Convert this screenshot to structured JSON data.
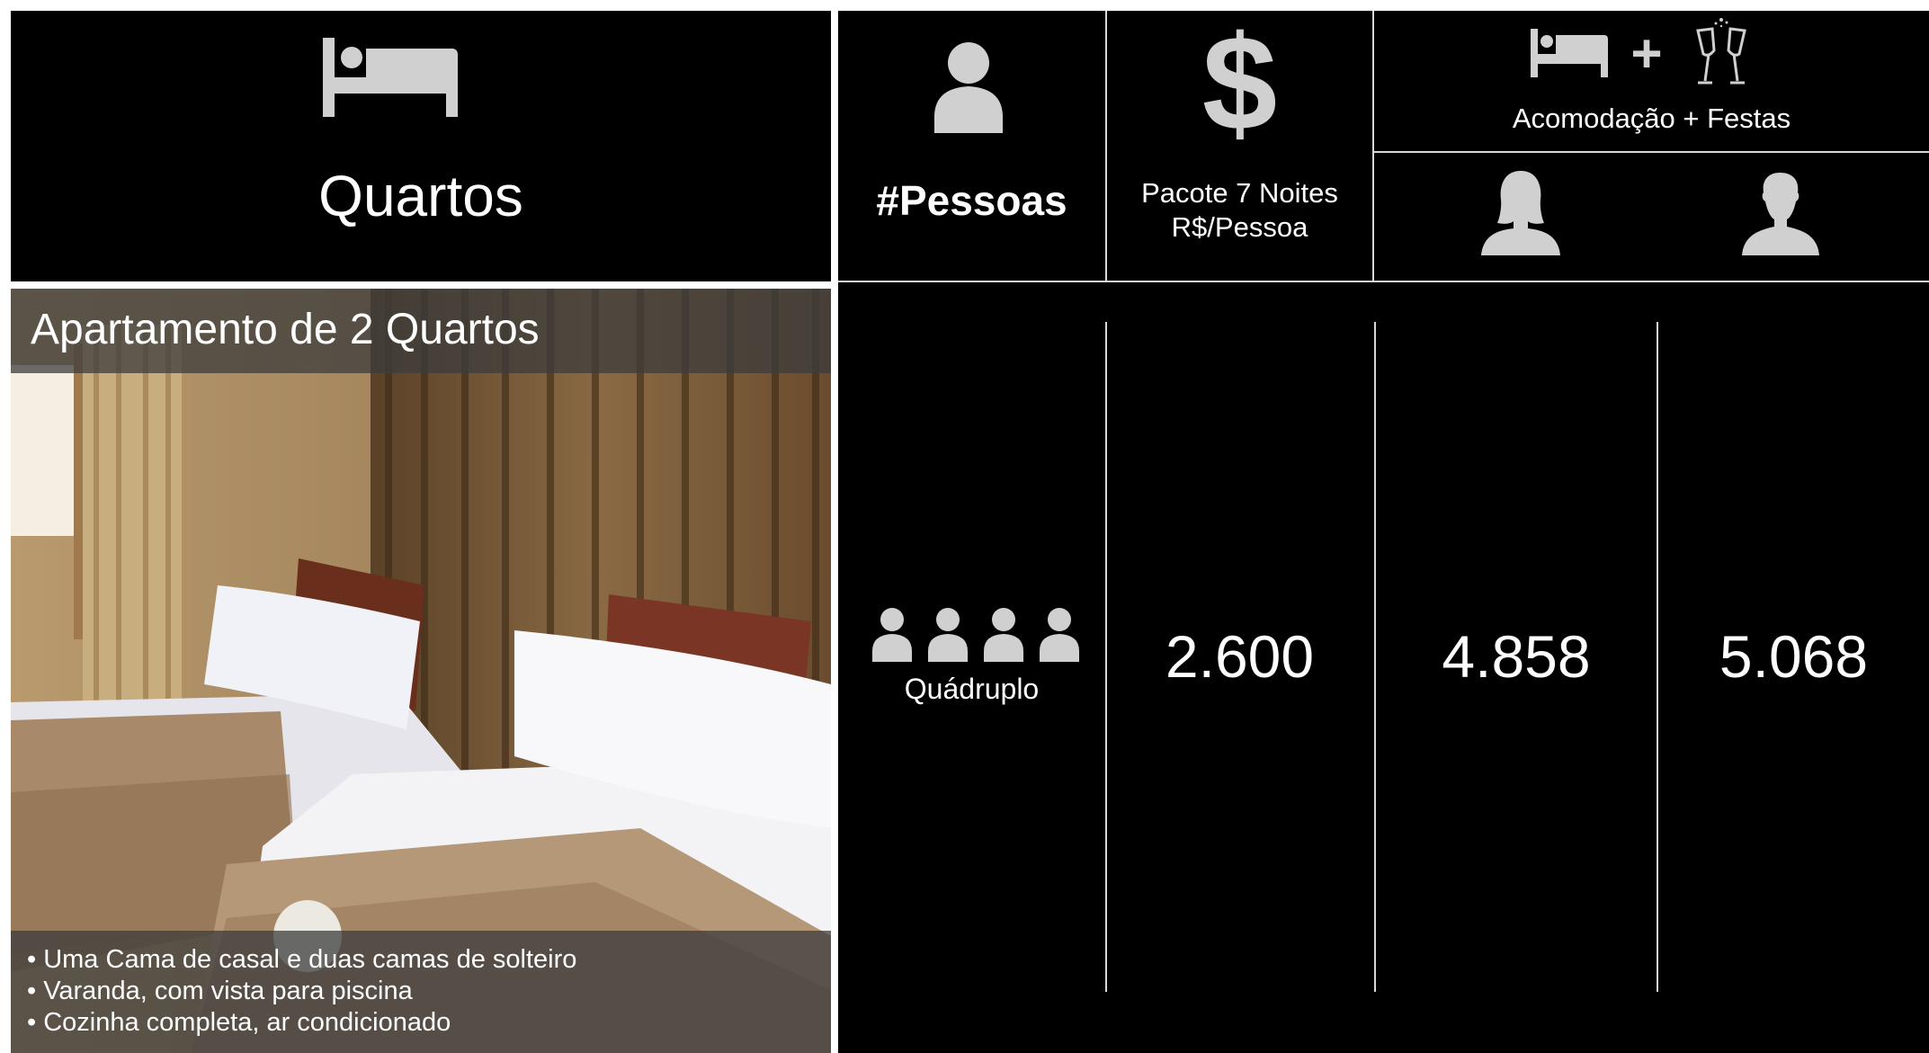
{
  "header": {
    "rooms_title": "Quartos",
    "people_title": "#Pessoas",
    "package_line1": "Pacote 7 Noites",
    "package_line2": "R$/Pessoa",
    "accommodation_title": "Acomodação + Festas",
    "icons": [
      "bed-icon",
      "person-icon",
      "dollar-icon",
      "champagne-icon",
      "female-silhouette-icon",
      "male-silhouette-icon"
    ]
  },
  "room": {
    "name": "Apartamento de 2 Quartos",
    "features": [
      "• Uma Cama de casal e duas camas de solteiro",
      "• Varanda, com vista para piscina",
      "• Cozinha completa, ar condicionado"
    ],
    "occupancy_label": "Quádruplo",
    "occupancy_count": 4,
    "package_price": "2.600",
    "female_price": "4.858",
    "male_price": "5.068"
  },
  "colors": {
    "background": "#000000",
    "text": "#ffffff",
    "icon": "#d0d0d0",
    "caption_overlay": "rgba(60,60,60,0.75)"
  }
}
